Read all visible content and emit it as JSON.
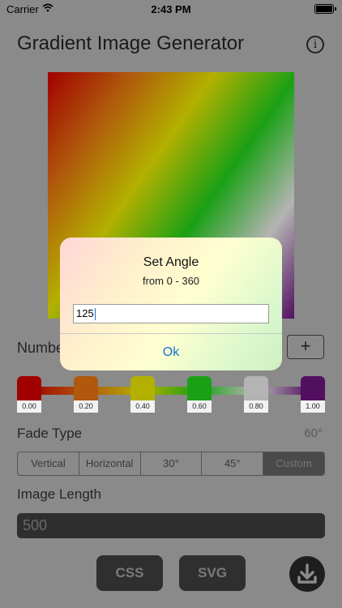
{
  "status_bar": {
    "carrier": "Carrier",
    "time": "2:43 PM"
  },
  "header": {
    "title": "Gradient Image Generator",
    "info_icon_label": "i"
  },
  "gradient": {
    "angle_deg": 125,
    "stops": [
      {
        "position_label": "0.00",
        "color": "#a10000"
      },
      {
        "position_label": "0.20",
        "color": "#b0580c"
      },
      {
        "position_label": "0.40",
        "color": "#b3b000"
      },
      {
        "position_label": "0.60",
        "color": "#1aa015"
      },
      {
        "position_label": "0.80",
        "color": "#b4b4b4"
      },
      {
        "position_label": "1.00",
        "color": "#520f60"
      }
    ]
  },
  "number_row": {
    "label": "Number",
    "plus_label": "+"
  },
  "fade": {
    "label": "Fade Type",
    "angle_value": "60°",
    "options": [
      "Vertical",
      "Horizontal",
      "30°",
      "45°",
      "Custom"
    ],
    "selected": "Custom"
  },
  "image_length": {
    "label": "Image Length",
    "value": "500"
  },
  "actions": {
    "css_label": "CSS",
    "svg_label": "SVG"
  },
  "dialog": {
    "title": "Set Angle",
    "subtitle": "from 0 - 360",
    "input_value": "125",
    "ok_label": "Ok"
  },
  "colors": {
    "accent": "#1a6fd6",
    "dim_background": "#8a8a8a"
  }
}
